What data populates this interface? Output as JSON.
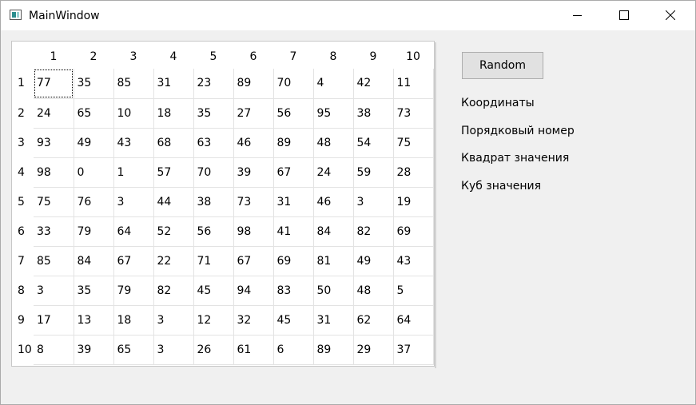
{
  "window": {
    "title": "MainWindow"
  },
  "table": {
    "column_headers": [
      "1",
      "2",
      "3",
      "4",
      "5",
      "6",
      "7",
      "8",
      "9",
      "10"
    ],
    "row_headers": [
      "1",
      "2",
      "3",
      "4",
      "5",
      "6",
      "7",
      "8",
      "9",
      "10"
    ],
    "rows": [
      [
        "77",
        "35",
        "85",
        "31",
        "23",
        "89",
        "70",
        "4",
        "42",
        "11"
      ],
      [
        "24",
        "65",
        "10",
        "18",
        "35",
        "27",
        "56",
        "95",
        "38",
        "73"
      ],
      [
        "93",
        "49",
        "43",
        "68",
        "63",
        "46",
        "89",
        "48",
        "54",
        "75"
      ],
      [
        "98",
        "0",
        "1",
        "57",
        "70",
        "39",
        "67",
        "24",
        "59",
        "28"
      ],
      [
        "75",
        "76",
        "3",
        "44",
        "38",
        "73",
        "31",
        "46",
        "3",
        "19"
      ],
      [
        "33",
        "79",
        "64",
        "52",
        "56",
        "98",
        "41",
        "84",
        "82",
        "69"
      ],
      [
        "85",
        "84",
        "67",
        "22",
        "71",
        "67",
        "69",
        "81",
        "49",
        "43"
      ],
      [
        "3",
        "35",
        "79",
        "82",
        "45",
        "94",
        "83",
        "50",
        "48",
        "5"
      ],
      [
        "17",
        "13",
        "18",
        "3",
        "12",
        "32",
        "45",
        "31",
        "62",
        "64"
      ],
      [
        "8",
        "39",
        "65",
        "3",
        "26",
        "61",
        "6",
        "89",
        "29",
        "37"
      ]
    ]
  },
  "side_panel": {
    "random_button": "Random",
    "coordinates_label": "Координаты",
    "ordinal_number_label": "Порядковый номер",
    "square_label": "Квадрат значения",
    "cube_label": "Куб значения"
  }
}
